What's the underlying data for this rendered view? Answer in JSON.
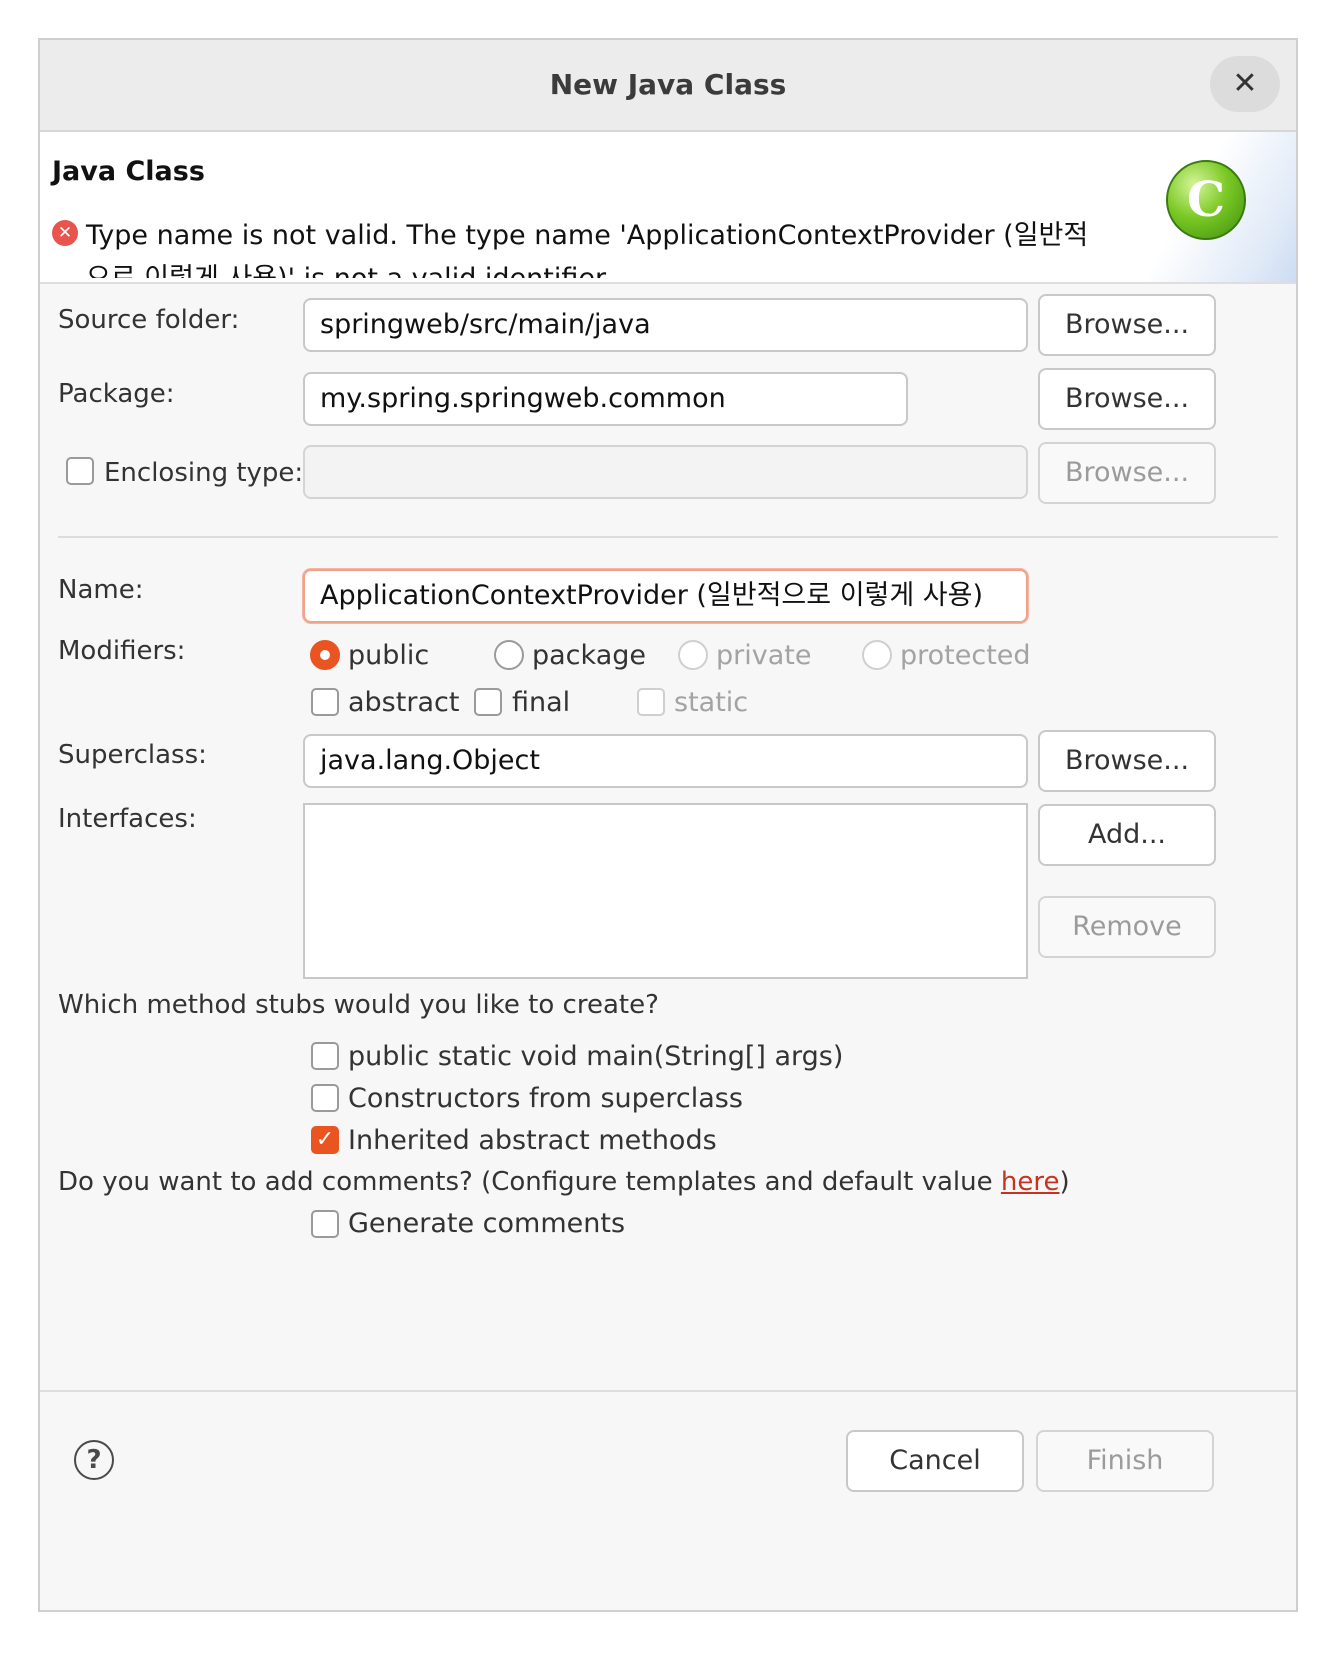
{
  "window": {
    "title": "New Java Class",
    "close_label": "✕"
  },
  "banner": {
    "title": "Java Class",
    "error_message": "Type name is not valid. The type name 'ApplicationContextProvider (일반적으로 이렇게 사용)' is not a valid identifier",
    "logo_letter": "C"
  },
  "form": {
    "source_folder": {
      "label": "Source folder:",
      "value": "springweb/src/main/java",
      "browse": "Browse..."
    },
    "package": {
      "label": "Package:",
      "value": "my.spring.springweb.common",
      "browse": "Browse..."
    },
    "enclosing_type": {
      "label": "Enclosing type:",
      "value": "",
      "browse": "Browse...",
      "checked": false
    },
    "name": {
      "label": "Name:",
      "value": "ApplicationContextProvider (일반적으로 이렇게 사용)"
    },
    "modifiers": {
      "label": "Modifiers:",
      "access": [
        "public",
        "package",
        "private",
        "protected"
      ],
      "selected": "public",
      "flags": [
        "abstract",
        "final",
        "static"
      ]
    },
    "superclass": {
      "label": "Superclass:",
      "value": "java.lang.Object",
      "browse": "Browse..."
    },
    "interfaces": {
      "label": "Interfaces:",
      "add": "Add...",
      "remove": "Remove",
      "items": []
    }
  },
  "stubs": {
    "question": "Which method stubs would you like to create?",
    "options": [
      {
        "label": "public static void main(String[] args)",
        "checked": false
      },
      {
        "label": "Constructors from superclass",
        "checked": false
      },
      {
        "label": "Inherited abstract methods",
        "checked": true
      }
    ]
  },
  "comments": {
    "question_prefix": "Do you want to add comments? (Configure templates and default value ",
    "link_text": "here",
    "question_suffix": ")",
    "generate_label": "Generate comments",
    "generate_checked": false
  },
  "footer": {
    "help": "?",
    "cancel": "Cancel",
    "finish": "Finish"
  },
  "colors": {
    "accent": "#e95420",
    "error": "#e8544e",
    "link": "#c7331f"
  }
}
